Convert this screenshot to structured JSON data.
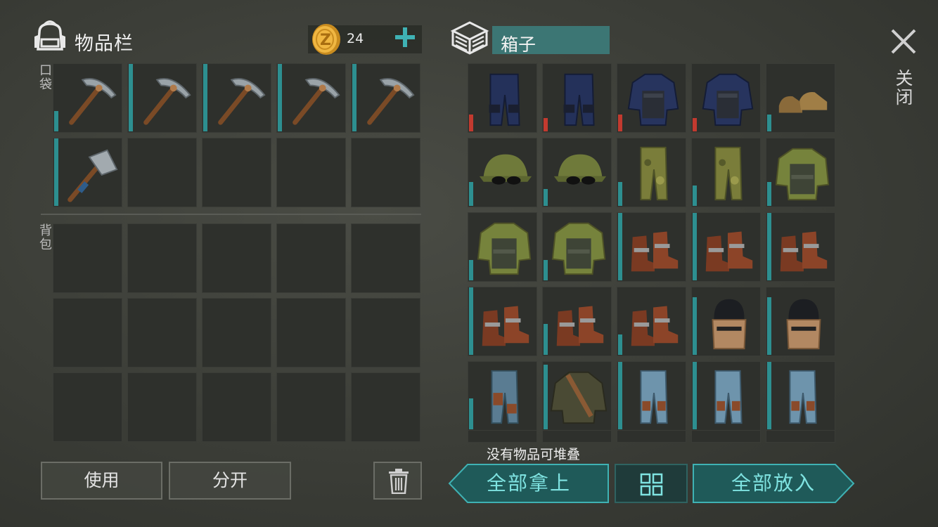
{
  "inventory": {
    "title": "物品栏",
    "coins": "24",
    "pocket_label": "口袋",
    "backpack_label": "背包"
  },
  "box": {
    "title": "箱子",
    "close_label": "关闭",
    "stack_message": "没有物品可堆叠"
  },
  "buttons": {
    "use": "使用",
    "split": "分开",
    "take_all": "全部拿上",
    "put_all": "全部放入"
  },
  "icons": {
    "bag": "backpack-icon",
    "coin": "coin-icon",
    "add": "plus-icon",
    "box": "crate-icon",
    "close": "close-icon",
    "trash": "trash-icon",
    "sort": "grid-sort-icon"
  },
  "colors": {
    "accent": "#3fb2b4",
    "durability": "#2d8f90",
    "durability_low": "#c23a2f",
    "slot_bg": "#2e302c"
  },
  "pocket_slots": [
    {
      "item": "pickaxe",
      "durability": 0.3
    },
    {
      "item": "pickaxe",
      "durability": 1.0
    },
    {
      "item": "pickaxe",
      "durability": 1.0
    },
    {
      "item": "pickaxe",
      "durability": 1.0
    },
    {
      "item": "pickaxe",
      "durability": 1.0
    },
    {
      "item": "hatchet",
      "durability": 1.0
    },
    {
      "item": "",
      "durability": 0
    },
    {
      "item": "",
      "durability": 0
    },
    {
      "item": "",
      "durability": 0
    },
    {
      "item": "",
      "durability": 0
    }
  ],
  "backpack_slots": 15,
  "box_slots": [
    {
      "item": "police-pants",
      "durability": 0.25,
      "low": true
    },
    {
      "item": "police-pants",
      "durability": 0.2,
      "low": true
    },
    {
      "item": "police-vest",
      "durability": 0.25,
      "low": true
    },
    {
      "item": "police-vest",
      "durability": 0.2,
      "low": true
    },
    {
      "item": "leather-shoes",
      "durability": 0.25
    },
    {
      "item": "camo-cap",
      "durability": 0.35
    },
    {
      "item": "camo-cap",
      "durability": 0.25
    },
    {
      "item": "camo-pants",
      "durability": 0.35
    },
    {
      "item": "camo-pants",
      "durability": 0.3
    },
    {
      "item": "camo-vest",
      "durability": 0.35
    },
    {
      "item": "camo-vest",
      "durability": 0.3
    },
    {
      "item": "camo-vest",
      "durability": 0.3
    },
    {
      "item": "leather-boots",
      "durability": 1.0
    },
    {
      "item": "leather-boots",
      "durability": 1.0
    },
    {
      "item": "leather-boots",
      "durability": 1.0
    },
    {
      "item": "leather-boots",
      "durability": 1.0
    },
    {
      "item": "leather-boots",
      "durability": 0.45
    },
    {
      "item": "leather-boots",
      "durability": 0.3
    },
    {
      "item": "metal-helmet",
      "durability": 0.85
    },
    {
      "item": "metal-helmet",
      "durability": 0.85
    },
    {
      "item": "patched-pants",
      "durability": 0.45
    },
    {
      "item": "bandolier-jacket",
      "durability": 0.95
    },
    {
      "item": "jeans-pants",
      "durability": 1.0
    },
    {
      "item": "jeans-pants",
      "durability": 1.0
    },
    {
      "item": "jeans-pants",
      "durability": 1.0
    }
  ]
}
